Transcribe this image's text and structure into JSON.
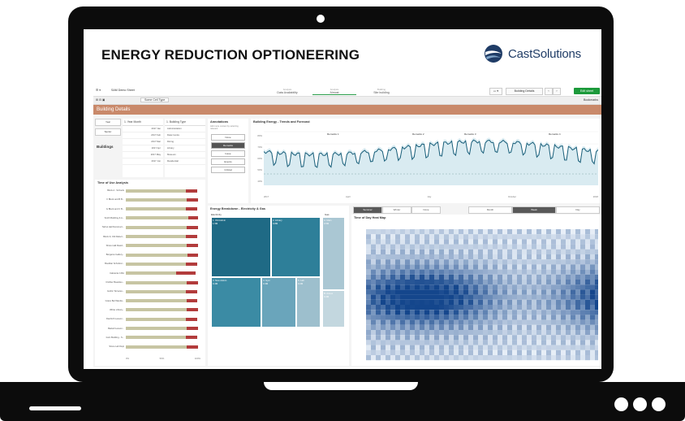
{
  "headline": "ENERGY REDUCTION OPTIONEERING",
  "logo_text": "CastSolutions",
  "colors": {
    "accent": "#c9896a",
    "brand": "#1f3c66",
    "green": "#1c9a3b",
    "teal": "#1a5f7a",
    "tou_red": "#b23c3c",
    "tou_bar": "#c7c5a3"
  },
  "app": {
    "title": "SAM Demo Sheet",
    "selectors": [
      {
        "label": "Analysis",
        "value": "Data Availability"
      },
      {
        "label": "Analysis",
        "value": "Almost"
      },
      {
        "label": "Building",
        "value": "Site building"
      }
    ],
    "building_details_label": "Building Details",
    "edit_sheet": "Edit sheet",
    "bookmarks": "Bookmarks",
    "tab": "Some Cell Type",
    "sheet_title": "Building Details"
  },
  "filters": {
    "left_btns": [
      "Year",
      "Sector"
    ],
    "buildings_label": "Buildings",
    "year_month_head": "1. Year Month",
    "year_months": [
      "2017 Jan",
      "2017 Feb",
      "2017 Mar",
      "2017 Apr",
      "2017 May",
      "2017 Jun"
    ],
    "building_type_head": "1. Building Type",
    "building_types": [
      "Administration",
      "Data Centre",
      "Dining",
      "Library",
      "Museum",
      "Residential"
    ]
  },
  "annotations": {
    "title": "Annotations",
    "subtitle": "Add more context by selecting relevant",
    "buttons": [
      "None",
      "Remarks",
      "Issue",
      "Events",
      "Critical"
    ],
    "selected": "Remarks"
  },
  "trend": {
    "title": "Building Energy - Trends and Forecast",
    "y_ticks": [
      "80%",
      "70%",
      "60%",
      "50%",
      "40%"
    ],
    "x_ticks": [
      "2017",
      "April",
      "July",
      "October",
      "2018"
    ],
    "annotations": [
      "Remarks 1",
      "Remarks 2",
      "Remarks 3",
      "Remarks 4"
    ]
  },
  "tou": {
    "title": "Time of Use Analysis",
    "rows": [
      {
        "label": "Block A - Schools",
        "bar": 0.9,
        "red": 0.2
      },
      {
        "label": "F Block and B B...",
        "bar": 0.92,
        "red": 0.18
      },
      {
        "label": "G Block and C B...",
        "bar": 0.9,
        "red": 0.2
      },
      {
        "label": "Smith Building & A...",
        "bar": 0.94,
        "red": 0.16
      },
      {
        "label": "Tarbut Hall Nonstruct...",
        "bar": 0.92,
        "red": 0.18
      },
      {
        "label": "Block D, Old Refect...",
        "bar": 0.9,
        "red": 0.2
      },
      {
        "label": "Shore Hall Resid...",
        "bar": 0.92,
        "red": 0.18
      },
      {
        "label": "Bergamo Gallery...",
        "bar": 0.94,
        "red": 0.17
      },
      {
        "label": "Bookfair Schnitzer...",
        "bar": 0.88,
        "red": 0.2
      },
      {
        "label": "Cafeteria C.BA",
        "bar": 0.7,
        "red": 0.33
      },
      {
        "label": "Clothier Beaulieu...",
        "bar": 0.92,
        "red": 0.18
      },
      {
        "label": "Gothic Terraces...",
        "bar": 0.9,
        "red": 0.2
      },
      {
        "label": "Grace Bel Wanda...",
        "bar": 0.91,
        "red": 0.19
      },
      {
        "label": "White Library...",
        "bar": 0.92,
        "red": 0.18
      },
      {
        "label": "Danforth Lesson...",
        "bar": 0.9,
        "red": 0.2
      },
      {
        "label": "Barkell Lesson...",
        "bar": 0.93,
        "red": 0.18
      },
      {
        "label": "Irwin Building - S...",
        "bar": 0.9,
        "red": 0.2
      },
      {
        "label": "Stone Lab Dept",
        "bar": 0.92,
        "red": 0.18
      }
    ],
    "x_ticks": [
      "0%",
      "50%",
      "100%"
    ]
  },
  "breakdown": {
    "title": "Energy Breakdown - Electricity & Gas",
    "electricity_label": "Electricity",
    "gas_label": "Gas",
    "cells": [
      "1. Old Admin",
      "2. Library",
      "3. New Admin",
      "4. Gym",
      "5. Lab",
      "A. Main",
      "B. Annex"
    ],
    "values": [
      "1.5M",
      "0.8M",
      "0.4M",
      "0.3M",
      "0.2M",
      "0.5M",
      "0.2M"
    ]
  },
  "segments": {
    "season": [
      "Summer",
      "Winter",
      "None"
    ],
    "season_selected": "Summer",
    "granularity": [
      "Month",
      "Week",
      "Day"
    ],
    "granularity_selected": "Week"
  },
  "heatmap": {
    "title": "Time of Day Heat Map"
  }
}
